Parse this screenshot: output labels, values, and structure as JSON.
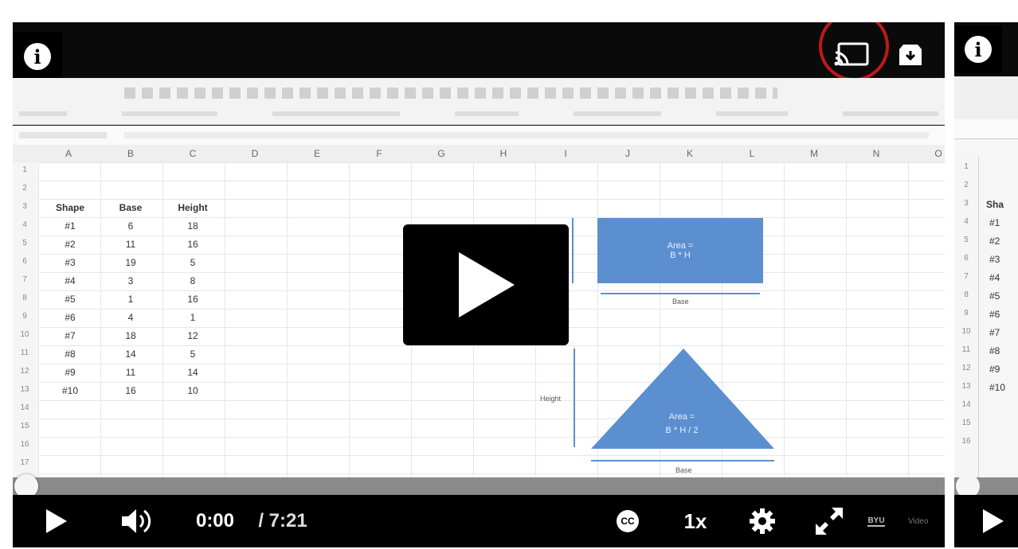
{
  "player": {
    "current_time": "0:00",
    "duration": "/ 7:21",
    "speed": "1x",
    "cc_label": "CC",
    "brand_label": "BYU",
    "brand_suffix": "Video",
    "progress_fraction": 0.0,
    "highlight_color": "#c0171d"
  },
  "spreadsheet": {
    "columns": [
      "A",
      "B",
      "C",
      "D",
      "E",
      "F",
      "G",
      "H",
      "I",
      "J",
      "K",
      "L",
      "M",
      "N",
      "O"
    ],
    "row_numbers": [
      "1",
      "2",
      "3",
      "4",
      "5",
      "6",
      "7",
      "8",
      "9",
      "10",
      "11",
      "12",
      "13",
      "14",
      "15",
      "16",
      "17"
    ],
    "header": {
      "shape": "Shape",
      "base": "Base",
      "height": "Height"
    },
    "rows": [
      {
        "shape": "#1",
        "base": "6",
        "height": "18"
      },
      {
        "shape": "#2",
        "base": "11",
        "height": "16"
      },
      {
        "shape": "#3",
        "base": "19",
        "height": "5"
      },
      {
        "shape": "#4",
        "base": "3",
        "height": "8"
      },
      {
        "shape": "#5",
        "base": "1",
        "height": "16"
      },
      {
        "shape": "#6",
        "base": "4",
        "height": "1"
      },
      {
        "shape": "#7",
        "base": "18",
        "height": "12"
      },
      {
        "shape": "#8",
        "base": "14",
        "height": "5"
      },
      {
        "shape": "#9",
        "base": "11",
        "height": "14"
      },
      {
        "shape": "#10",
        "base": "16",
        "height": "10"
      }
    ],
    "rect_formula_line1": "Area =",
    "rect_formula_line2": "B * H",
    "tri_formula_line1": "Area =",
    "tri_formula_line2": "B * H / 2",
    "label_base": "Base",
    "label_height": "Height",
    "shape_color": "#5b8fd0"
  },
  "next_video": {
    "row_numbers": [
      "1",
      "2",
      "3",
      "4",
      "5",
      "6",
      "7",
      "8",
      "9",
      "10",
      "11",
      "12",
      "13",
      "14",
      "15",
      "16"
    ],
    "shape_prefix": "Sha",
    "shapes": [
      "#1",
      "#2",
      "#3",
      "#4",
      "#5",
      "#6",
      "#7",
      "#8",
      "#9",
      "#10"
    ]
  }
}
